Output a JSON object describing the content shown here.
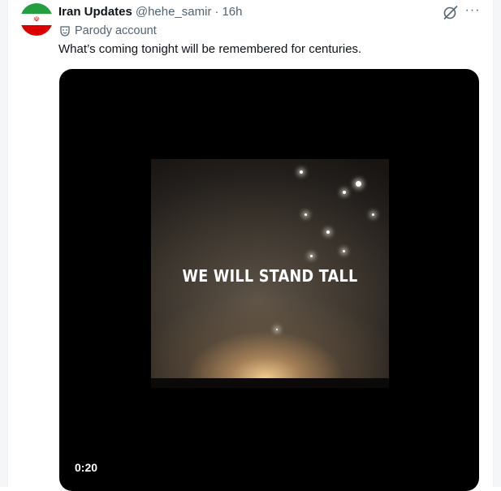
{
  "tweet": {
    "author_name": "Iran Updates",
    "handle": "@hehe_samir",
    "separator": "·",
    "time": "16h",
    "badge_label": "Parody account",
    "text": "What’s coming tonight will be remembered for centuries.",
    "more_icon": "···",
    "avatar": {
      "flag_colors": [
        "#239f40",
        "#ffffff",
        "#da0000"
      ],
      "emblem": "☫"
    }
  },
  "media": {
    "overlay_text": "WE WILL STAND TALL",
    "duration": "0:20"
  },
  "icons": {
    "grok": "grok-icon",
    "more": "more-icon",
    "parody": "theater-mask-icon"
  },
  "colors": {
    "text_primary": "#0f1419",
    "text_secondary": "#536471",
    "media_bg": "#000000"
  }
}
